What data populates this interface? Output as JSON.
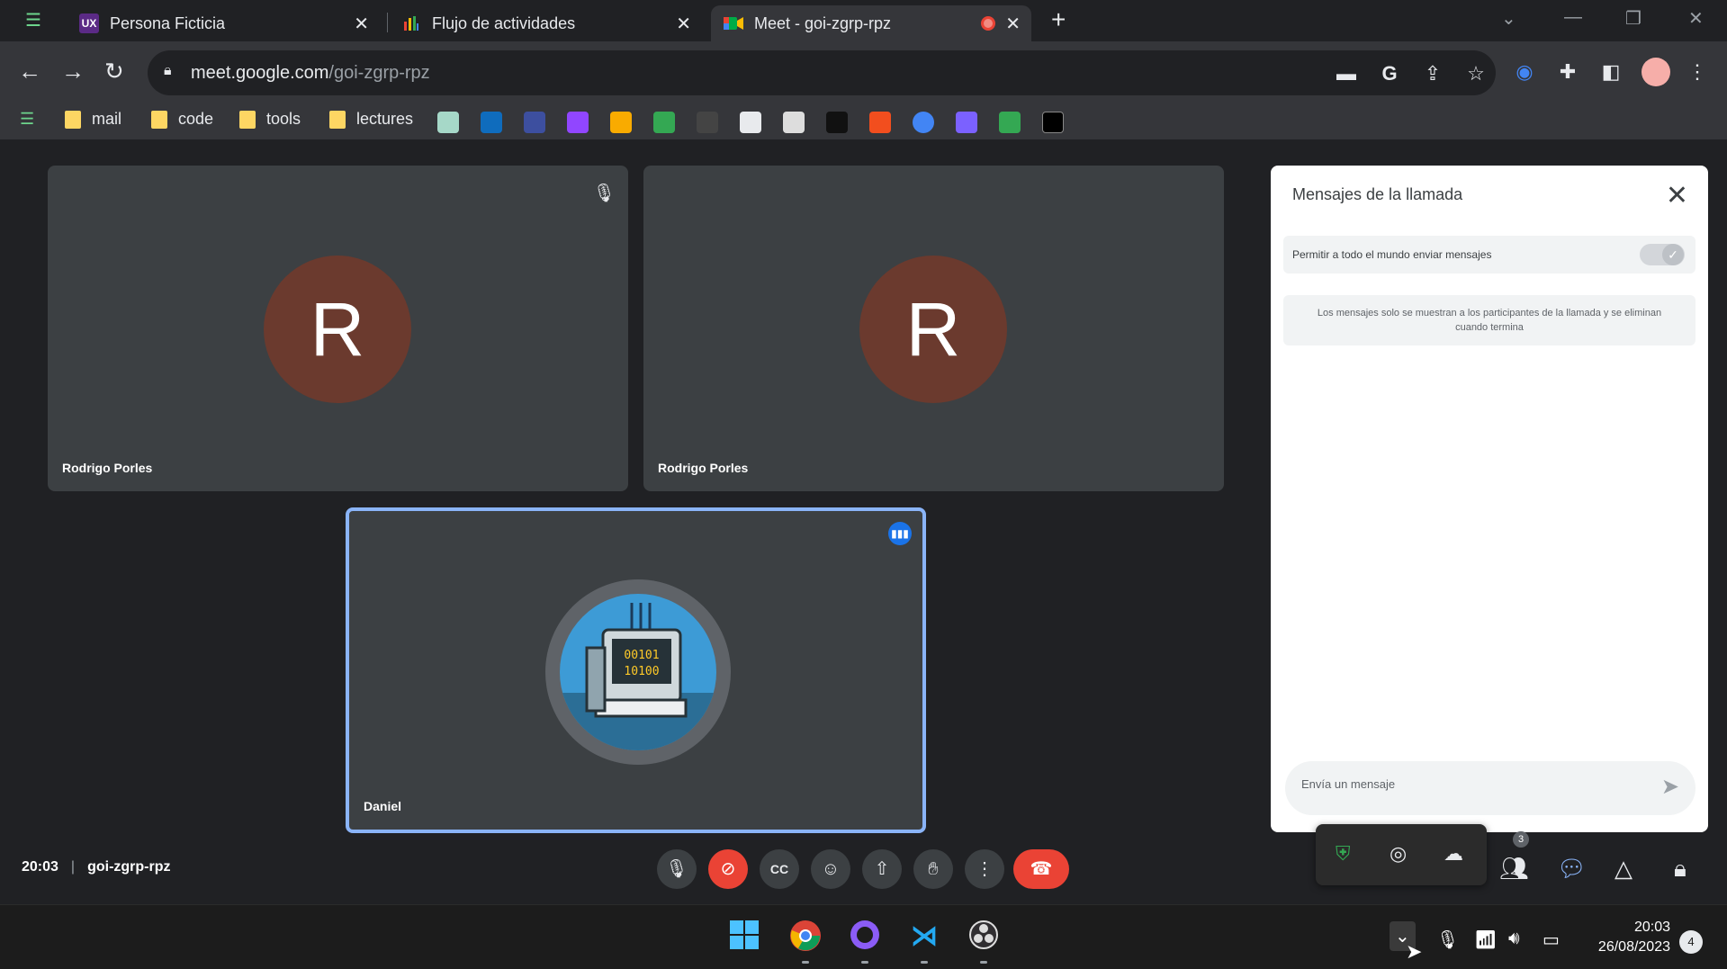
{
  "browser": {
    "tabs": [
      {
        "title": "Persona Ficticia",
        "icon": "ux-icon"
      },
      {
        "title": "Flujo de actividades",
        "icon": "chart-icon"
      },
      {
        "title": "Meet - goi-zgrp-rpz",
        "icon": "meet-icon"
      }
    ],
    "url_host": "meet.google.com",
    "url_path": "/goi-zgrp-rpz",
    "bookmarks": [
      "mail",
      "code",
      "tools",
      "lectures"
    ]
  },
  "meeting": {
    "participants": [
      {
        "name": "Rodrigo Porles",
        "initial": "R",
        "muted": true
      },
      {
        "name": "Rodrigo Porles",
        "initial": "R",
        "muted": false
      },
      {
        "name": "Daniel",
        "speaking": true
      }
    ],
    "time": "20:03",
    "code": "goi-zgrp-rpz",
    "people_count": "3"
  },
  "chat_panel": {
    "title": "Mensajes de la llamada",
    "permission_label": "Permitir a todo el mundo enviar mensajes",
    "info_text": "Los mensajes solo se muestran a los participantes de la llamada y se eliminan cuando termina",
    "input_placeholder": "Envía un mensaje"
  },
  "taskbar": {
    "time": "20:03",
    "date": "26/08/2023",
    "notifications": "4"
  },
  "colors": {
    "accent": "#8ab4f8",
    "danger": "#ea4335",
    "avatar": "#6b3a2e"
  }
}
